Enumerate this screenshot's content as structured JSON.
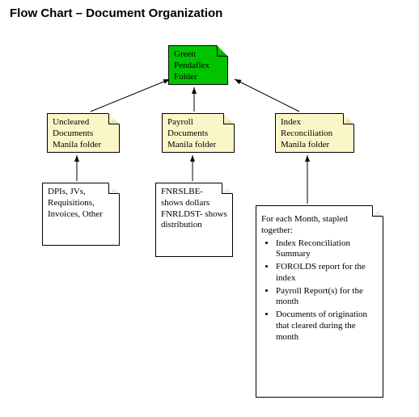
{
  "title": "Flow Chart – Document Organization",
  "top_node": {
    "line1": "Green",
    "line2": "Pendaflex",
    "line3": "Folder"
  },
  "mid_nodes": {
    "left": {
      "line1": "Uncleared",
      "line2": "Documents",
      "line3": "Manila folder"
    },
    "center": {
      "line1": "Payroll",
      "line2": "Documents",
      "line3": "Manila folder"
    },
    "right": {
      "line1": "Index",
      "line2": "Reconciliation",
      "line3": "Manila folder"
    }
  },
  "details": {
    "left": "DPIs, JVs, Requisitions, Invoices, Other",
    "center": "FNRSLBE- shows dollars FNRLDST- shows distribution",
    "right_intro": "For each Month, stapled together:",
    "right_bullets": [
      "Index Reconciliation Summary",
      "FOROLDS report for the index",
      "Payroll Report(s) for the month",
      "Documents of origination that cleared during the month"
    ]
  }
}
